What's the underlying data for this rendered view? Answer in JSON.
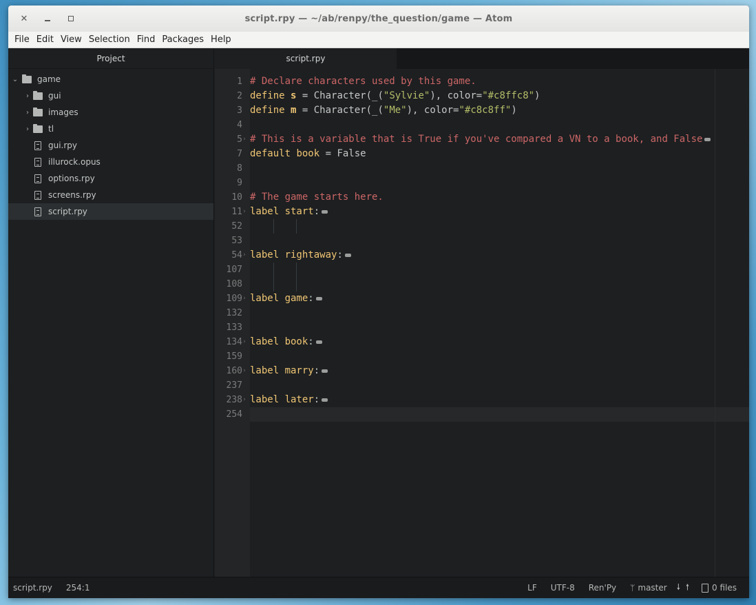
{
  "window": {
    "title": "script.rpy — ~/ab/renpy/the_question/game — Atom"
  },
  "menu": [
    "File",
    "Edit",
    "View",
    "Selection",
    "Find",
    "Packages",
    "Help"
  ],
  "sidebar": {
    "header": "Project",
    "root": "game",
    "folders": [
      "gui",
      "images",
      "tl"
    ],
    "files": [
      "gui.rpy",
      "illurock.opus",
      "options.rpy",
      "screens.rpy",
      "script.rpy"
    ],
    "selected": "script.rpy"
  },
  "tab": {
    "label": "script.rpy"
  },
  "editor": {
    "lines": [
      {
        "num": "1",
        "fold": false,
        "segs": [
          {
            "t": "# Declare characters used by this game.",
            "c": "comment"
          }
        ]
      },
      {
        "num": "2",
        "fold": false,
        "segs": [
          {
            "t": "define ",
            "c": "key"
          },
          {
            "t": "s",
            "c": "bold"
          },
          {
            "t": " = Character(_(",
            "c": "fn"
          },
          {
            "t": "\"Sylvie\"",
            "c": "str"
          },
          {
            "t": "), color=",
            "c": "fn"
          },
          {
            "t": "\"#c8ffc8\"",
            "c": "str"
          },
          {
            "t": ")",
            "c": "fn"
          }
        ]
      },
      {
        "num": "3",
        "fold": false,
        "segs": [
          {
            "t": "define ",
            "c": "key"
          },
          {
            "t": "m",
            "c": "bold"
          },
          {
            "t": " = Character(_(",
            "c": "fn"
          },
          {
            "t": "\"Me\"",
            "c": "str"
          },
          {
            "t": "), color=",
            "c": "fn"
          },
          {
            "t": "\"#c8c8ff\"",
            "c": "str"
          },
          {
            "t": ")",
            "c": "fn"
          }
        ]
      },
      {
        "num": "4",
        "fold": false,
        "segs": []
      },
      {
        "num": "5",
        "fold": true,
        "segs": [
          {
            "t": "# This is a variable that is True if you've compared a VN to a book, and False",
            "c": "comment"
          }
        ],
        "mark": true
      },
      {
        "num": "7",
        "fold": false,
        "segs": [
          {
            "t": "default ",
            "c": "key"
          },
          {
            "t": "book",
            "c": "key"
          },
          {
            "t": " = False",
            "c": "fn"
          }
        ]
      },
      {
        "num": "8",
        "fold": false,
        "segs": []
      },
      {
        "num": "9",
        "fold": false,
        "segs": []
      },
      {
        "num": "10",
        "fold": false,
        "segs": [
          {
            "t": "# The game starts here.",
            "c": "comment"
          }
        ]
      },
      {
        "num": "11",
        "fold": true,
        "segs": [
          {
            "t": "label ",
            "c": "key"
          },
          {
            "t": "start",
            "c": "key"
          },
          {
            "t": ":",
            "c": "fn"
          }
        ],
        "mark": true
      },
      {
        "num": "52",
        "fold": false,
        "segs": [],
        "guides": true
      },
      {
        "num": "53",
        "fold": false,
        "segs": []
      },
      {
        "num": "54",
        "fold": true,
        "segs": [
          {
            "t": "label ",
            "c": "key"
          },
          {
            "t": "rightaway",
            "c": "key"
          },
          {
            "t": ":",
            "c": "fn"
          }
        ],
        "mark": true
      },
      {
        "num": "107",
        "fold": false,
        "segs": [],
        "guides": true
      },
      {
        "num": "108",
        "fold": false,
        "segs": [],
        "guides": true
      },
      {
        "num": "109",
        "fold": true,
        "segs": [
          {
            "t": "label ",
            "c": "key"
          },
          {
            "t": "game",
            "c": "key"
          },
          {
            "t": ":",
            "c": "fn"
          }
        ],
        "mark": true
      },
      {
        "num": "132",
        "fold": false,
        "segs": []
      },
      {
        "num": "133",
        "fold": false,
        "segs": []
      },
      {
        "num": "134",
        "fold": true,
        "segs": [
          {
            "t": "label ",
            "c": "key"
          },
          {
            "t": "book",
            "c": "key"
          },
          {
            "t": ":",
            "c": "fn"
          }
        ],
        "mark": true
      },
      {
        "num": "159",
        "fold": false,
        "segs": []
      },
      {
        "num": "160",
        "fold": true,
        "segs": [
          {
            "t": "label ",
            "c": "key"
          },
          {
            "t": "marry",
            "c": "key"
          },
          {
            "t": ":",
            "c": "fn"
          }
        ],
        "mark": true
      },
      {
        "num": "237",
        "fold": false,
        "segs": []
      },
      {
        "num": "238",
        "fold": true,
        "segs": [
          {
            "t": "label ",
            "c": "key"
          },
          {
            "t": "later",
            "c": "key"
          },
          {
            "t": ":",
            "c": "fn"
          }
        ],
        "mark": true
      },
      {
        "num": "254",
        "fold": false,
        "segs": [],
        "cursor": true
      }
    ]
  },
  "status": {
    "file": "script.rpy",
    "position": "254:1",
    "line_ending": "LF",
    "encoding": "UTF-8",
    "grammar": "Ren'Py",
    "branch": "master",
    "files": "0 files"
  }
}
